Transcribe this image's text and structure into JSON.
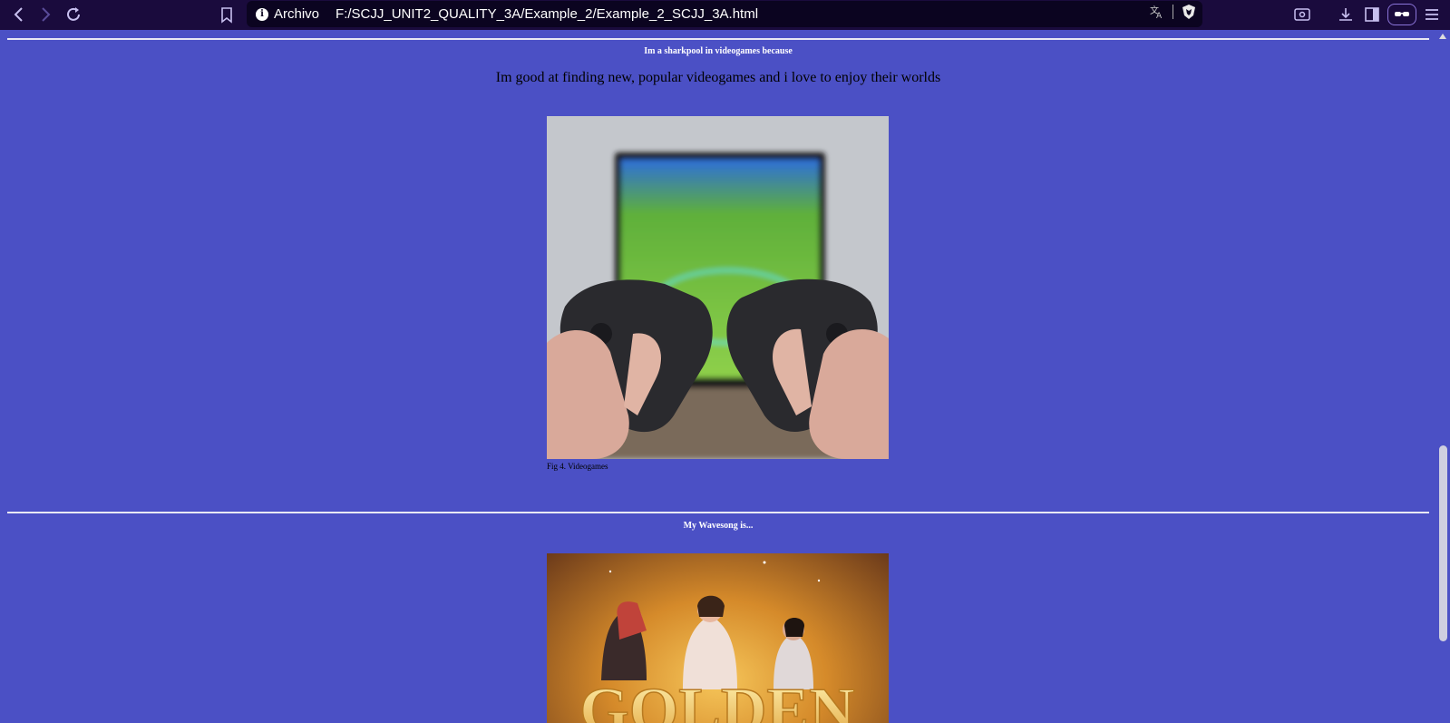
{
  "browser": {
    "back_icon": "chevron-left-icon",
    "forward_icon": "chevron-right-icon",
    "reload_icon": "reload-icon",
    "bookmark_icon": "bookmark-icon",
    "address": {
      "scheme_label": "Archivo",
      "url": "F:/SCJJ_UNIT2_QUALITY_3A/Example_2/Example_2_SCJJ_3A.html"
    },
    "translate_icon": "translate-icon",
    "brave_shield_icon": "brave-shield-icon",
    "right_icons": [
      "screenshot-icon",
      "download-icon",
      "sidebar-icon",
      "leo-icon",
      "menu-icon"
    ]
  },
  "sections": {
    "videogames": {
      "title": "Im a sharkpool in videogames because",
      "text": "Im good at finding new, popular videogames and i love to enjoy their worlds",
      "caption": "Fig 4. Videogames"
    },
    "wavesong": {
      "title": "My Wavesong is..."
    }
  },
  "colors": {
    "page_background": "#4b50c5",
    "toolbar_background": "#1a0b3d",
    "address_bar_background": "#0b0420",
    "heading_text": "#ffffff",
    "body_text": "#000000"
  }
}
